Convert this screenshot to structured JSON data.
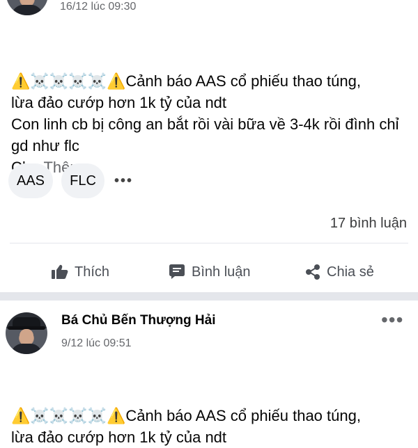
{
  "posts": [
    {
      "timestamp": "16/12 lúc 09:30",
      "emoji_row": "⚠️☠️☠️☠️☠️⚠️",
      "text_first_line": "Cảnh báo AAS cổ phiếu thao túng,",
      "text_rest": "lừa đảo cướp hơn 1k tỷ của ndt\nCon linh cb bị công an bắt rồi vài bữa về 3-4k rồi đình chỉ gd như flc\nCh",
      "see_more": "...Thêm",
      "hashtags": [
        "AAS",
        "FLC"
      ],
      "comments_count": "17 bình luận",
      "actions": {
        "like": "Thích",
        "comment": "Bình luận",
        "share": "Chia sẻ"
      }
    },
    {
      "author": "Bá Chủ Bến Thượng Hải",
      "timestamp": "9/12 lúc 09:51",
      "emoji_row": "⚠️☠️☠️☠️☠️⚠️",
      "text_first_line": "Cảnh báo AAS cổ phiếu thao túng,",
      "text_rest": "lừa đảo cướp hơn 1k tỷ của ndt"
    }
  ],
  "icons": {
    "warning": "⚠️",
    "skull": "☠️",
    "more": "•••",
    "like": "thumbs-up-icon",
    "comment": "speech-bubble-icon",
    "share": "share-icon"
  }
}
